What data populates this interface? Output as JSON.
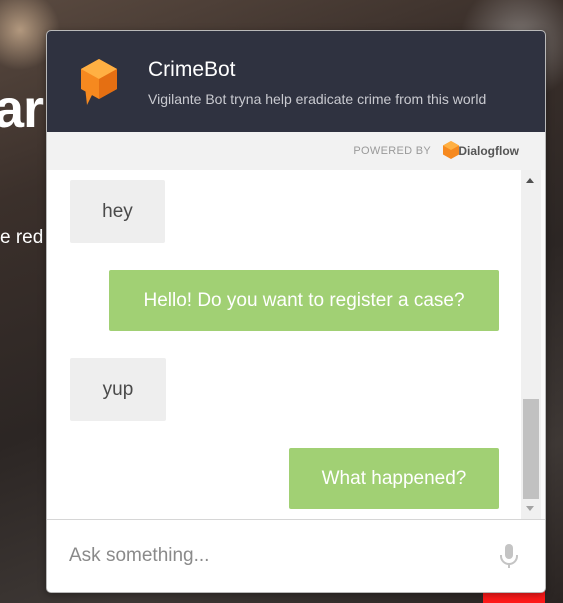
{
  "background": {
    "heading_fragment": "ar",
    "text_fragment": "e red"
  },
  "chat": {
    "title": "CrimeBot",
    "subtitle": "Vigilante Bot tryna help eradicate crime from this world",
    "powered_by_label": "POWERED BY",
    "powered_by_brand": "Dialogflow",
    "messages": [
      {
        "from": "user",
        "text": "hey"
      },
      {
        "from": "bot",
        "text": "Hello! Do you want to register a case?"
      },
      {
        "from": "user",
        "text": "yup"
      },
      {
        "from": "bot",
        "text": "What happened?"
      }
    ],
    "input_placeholder": "Ask something...",
    "icons": {
      "logo": "chat-bubble-cube-icon",
      "dialogflow": "dialogflow-logo-icon",
      "mic": "microphone-icon"
    }
  },
  "colors": {
    "header_bg": "#2f3240",
    "bot_bubble": "#a1d074",
    "user_bubble": "#eeeeee",
    "logo_orange": "#f6891f"
  }
}
